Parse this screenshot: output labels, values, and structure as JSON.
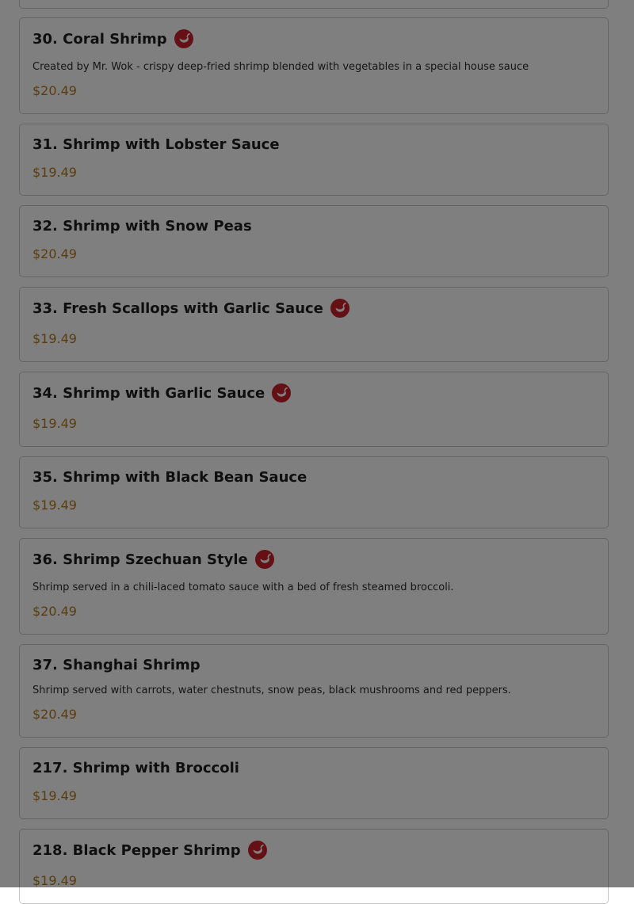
{
  "menu": {
    "items": [
      {
        "title": "30. Coral Shrimp",
        "spicy": true,
        "description": "Created by Mr. Wok - crispy deep-fried shrimp blended with vegetables in a special house sauce",
        "price": "$20.49"
      },
      {
        "title": "31. Shrimp with Lobster Sauce",
        "spicy": false,
        "description": "",
        "price": "$19.49"
      },
      {
        "title": "32. Shrimp with Snow Peas",
        "spicy": false,
        "description": "",
        "price": "$20.49"
      },
      {
        "title": "33. Fresh Scallops with Garlic Sauce",
        "spicy": true,
        "description": "",
        "price": "$19.49"
      },
      {
        "title": "34. Shrimp with Garlic Sauce",
        "spicy": true,
        "description": "",
        "price": "$19.49"
      },
      {
        "title": "35. Shrimp with Black Bean Sauce",
        "spicy": false,
        "description": "",
        "price": "$19.49"
      },
      {
        "title": "36. Shrimp Szechuan Style",
        "spicy": true,
        "description": "Shrimp served in a chili-laced tomato sauce with a bed of fresh steamed broccoli.",
        "price": "$20.49"
      },
      {
        "title": "37. Shanghai Shrimp",
        "spicy": false,
        "description": "Shrimp served with carrots, water chestnuts, snow peas, black mushrooms and red peppers.",
        "price": "$20.49"
      },
      {
        "title": "217. Shrimp with Broccoli",
        "spicy": false,
        "description": "",
        "price": "$19.49"
      },
      {
        "title": "218. Black Pepper Shrimp",
        "spicy": true,
        "description": "",
        "price": "$19.49"
      }
    ]
  },
  "colors": {
    "price": "#b57a1e",
    "spicy_badge": "#c8202a",
    "overlay": "rgba(0,0,0,0.5)"
  },
  "icons": {
    "spicy": "chili-pepper-icon"
  }
}
